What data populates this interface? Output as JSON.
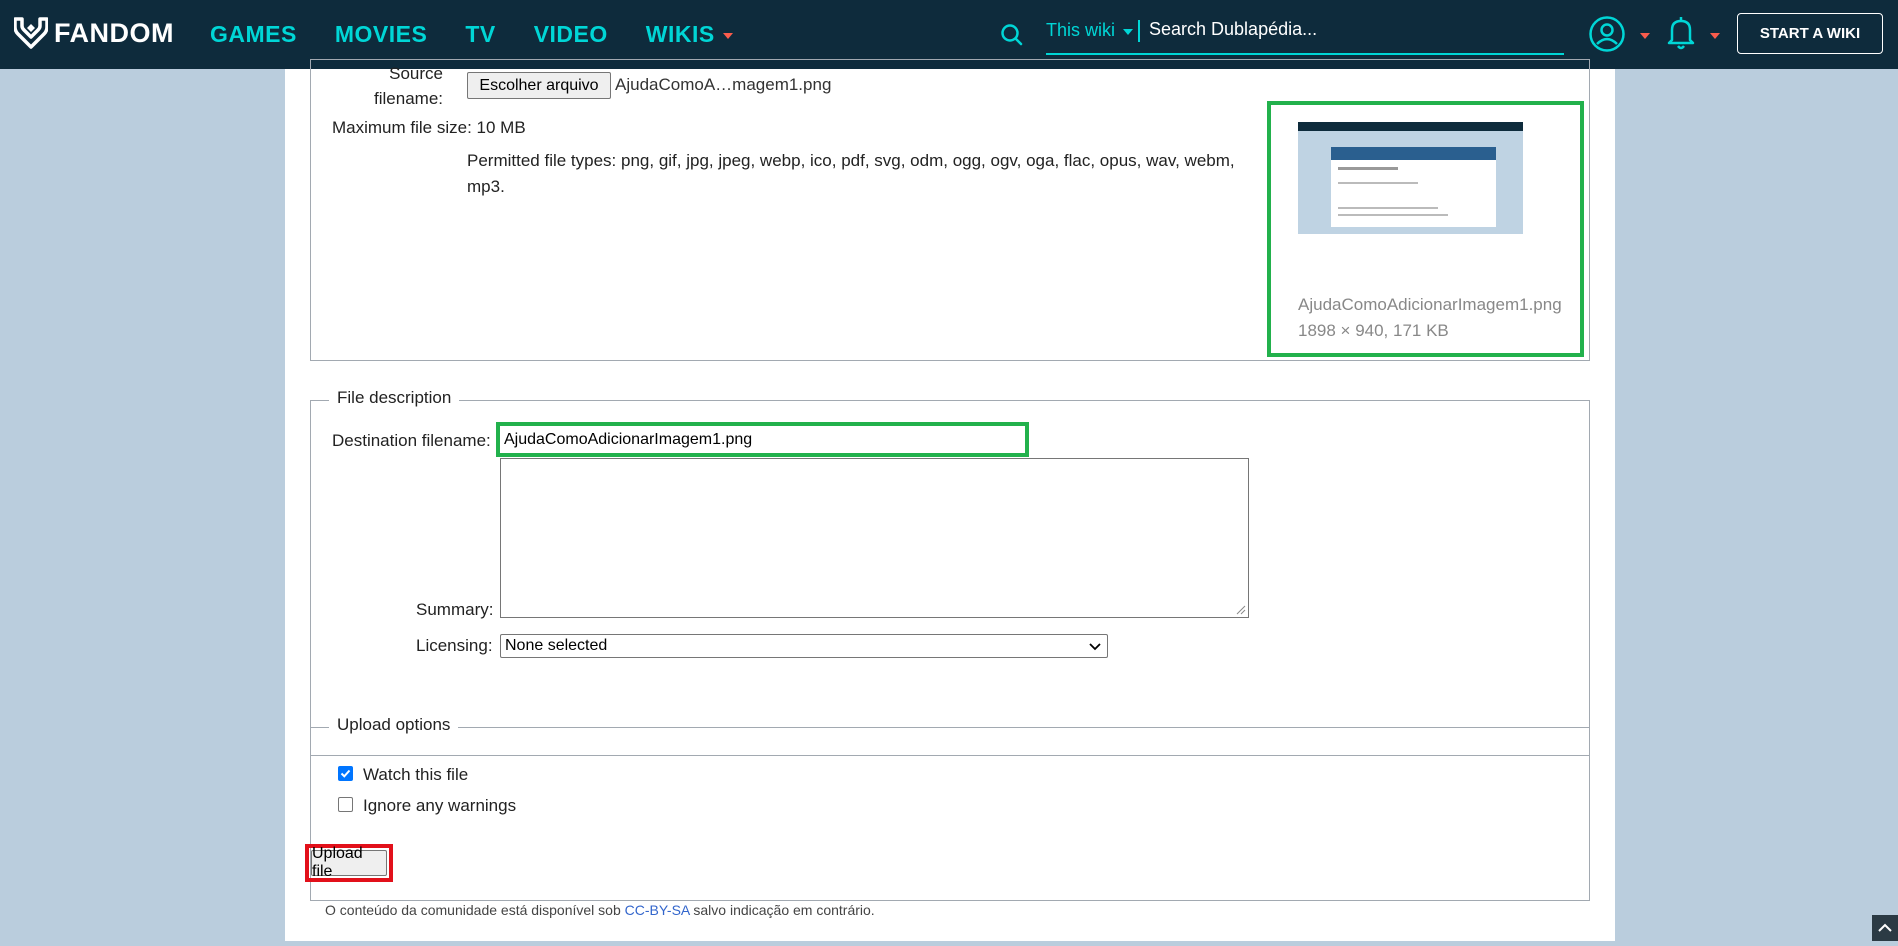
{
  "nav": {
    "brand": "FANDOM",
    "items": [
      "GAMES",
      "MOVIES",
      "TV",
      "VIDEO",
      "WIKIS"
    ],
    "search_scope": "This wiki",
    "search_placeholder": "Search Dublapédia...",
    "start_wiki": "START A WIKI",
    "colors": {
      "bar": "#0e2b3c",
      "accent": "#00d6d6",
      "caret": "#fa5c4c"
    }
  },
  "source": {
    "label_line1": "Source",
    "label_line2": "filename:",
    "choose_button": "Escolher arquivo",
    "chosen_file": "AjudaComoA…magem1.png",
    "max_size_label": "Maximum file size: 10 MB",
    "permitted_line1": "Permitted file types: png, gif, jpg, jpeg, webp, ico, pdf, svg, odm, ogg, ogv, oga, flac, opus, wav, webm,",
    "permitted_line2": "mp3."
  },
  "preview": {
    "filename": "AjudaComoAdicionarImagem1.png",
    "meta": "1898 × 940, 171 KB"
  },
  "description": {
    "legend": "File description",
    "dest_label": "Destination filename:",
    "dest_value": "AjudaComoAdicionarImagem1.png",
    "summary_label": "Summary:",
    "licensing_label": "Licensing:",
    "licensing_value": "None selected"
  },
  "options": {
    "legend": "Upload options",
    "watch_label": "Watch this file",
    "watch_checked": true,
    "ignore_label": "Ignore any warnings",
    "ignore_checked": false
  },
  "upload_button": "Upload file",
  "footer": {
    "prefix": "O conteúdo da comunidade está disponível sob ",
    "link": "CC-BY-SA",
    "suffix": " salvo indicação em contrário."
  },
  "highlight_colors": {
    "green": "#22b14c",
    "red": "#e2101a"
  }
}
